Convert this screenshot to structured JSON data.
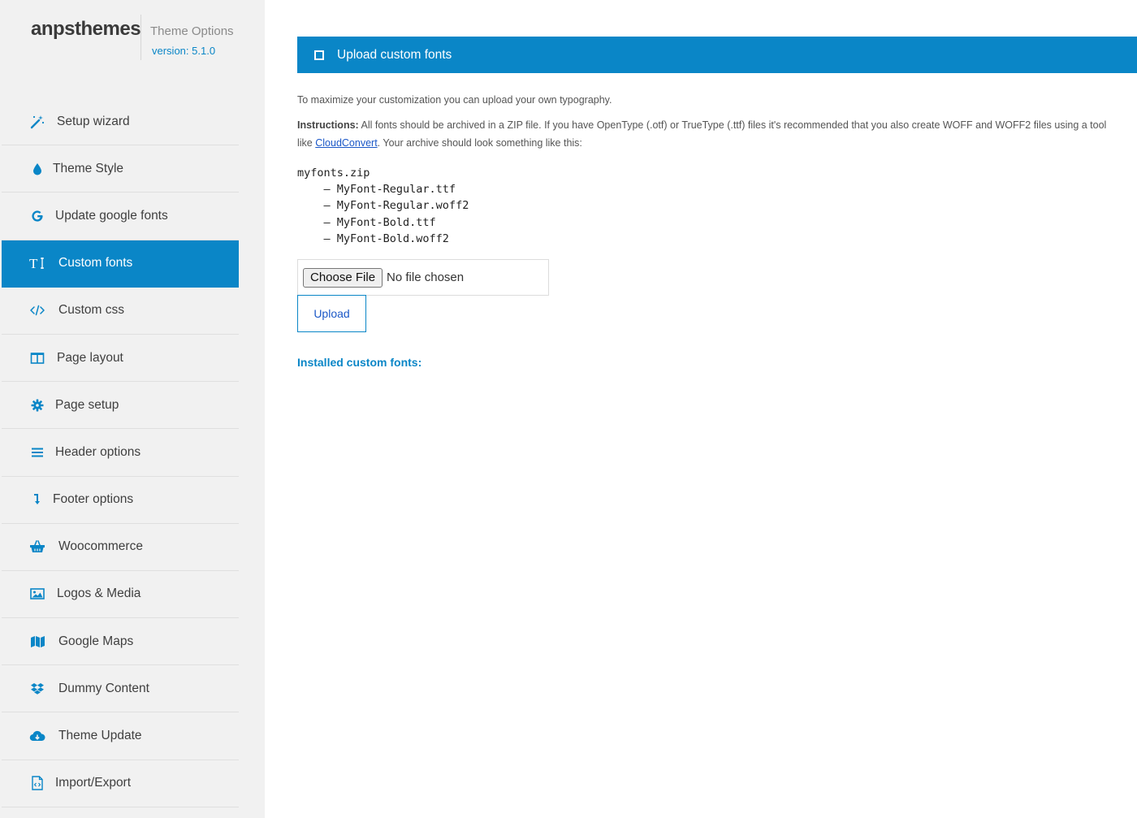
{
  "brand": {
    "name": "anpsthemes",
    "subtitle": "Theme Options",
    "version": "version: 5.1.0"
  },
  "sidebar": {
    "items": [
      {
        "label": "Setup wizard",
        "icon": "magic-wand-icon"
      },
      {
        "label": "Theme Style",
        "icon": "droplet-icon"
      },
      {
        "label": "Update google fonts",
        "icon": "google-g-icon"
      },
      {
        "label": "Custom fonts",
        "icon": "text-height-icon",
        "active": true
      },
      {
        "label": "Custom css",
        "icon": "code-icon"
      },
      {
        "label": "Page layout",
        "icon": "columns-icon"
      },
      {
        "label": "Page setup",
        "icon": "gear-icon"
      },
      {
        "label": "Header options",
        "icon": "menu-lines-icon"
      },
      {
        "label": "Footer options",
        "icon": "arrow-down-turn-icon"
      },
      {
        "label": "Woocommerce",
        "icon": "shopping-basket-icon"
      },
      {
        "label": "Logos & Media",
        "icon": "image-icon"
      },
      {
        "label": "Google Maps",
        "icon": "map-icon"
      },
      {
        "label": "Dummy Content",
        "icon": "dropbox-icon"
      },
      {
        "label": "Theme Update",
        "icon": "cloud-download-icon"
      },
      {
        "label": "Import/Export",
        "icon": "file-code-icon"
      }
    ]
  },
  "main": {
    "section_title": "Upload custom fonts",
    "intro": "To maximize your customization you can upload your own typography.",
    "instructions": {
      "prefix": "Instructions:",
      "text_before_link": " All fonts should be archived in a ZIP file. If you have OpenType (.otf) or TrueType (.ttf) files it's recommended that you also create WOFF and WOFF2 files using a tool like ",
      "link_text": "CloudConvert",
      "text_after_link": ". Your archive should look something like this:"
    },
    "code_lines": [
      "myfonts.zip",
      "    – MyFont-Regular.ttf",
      "    – MyFont-Regular.woff2",
      "    – MyFont-Bold.ttf",
      "    – MyFont-Bold.woff2"
    ],
    "file_input": {
      "button_label": "Choose File",
      "status": "No file chosen"
    },
    "upload_label": "Upload",
    "installed_heading": "Installed custom fonts:"
  },
  "colors": {
    "accent": "#0a86c7",
    "sidebar_bg": "#f1f1f1",
    "link": "#1a57c7"
  }
}
